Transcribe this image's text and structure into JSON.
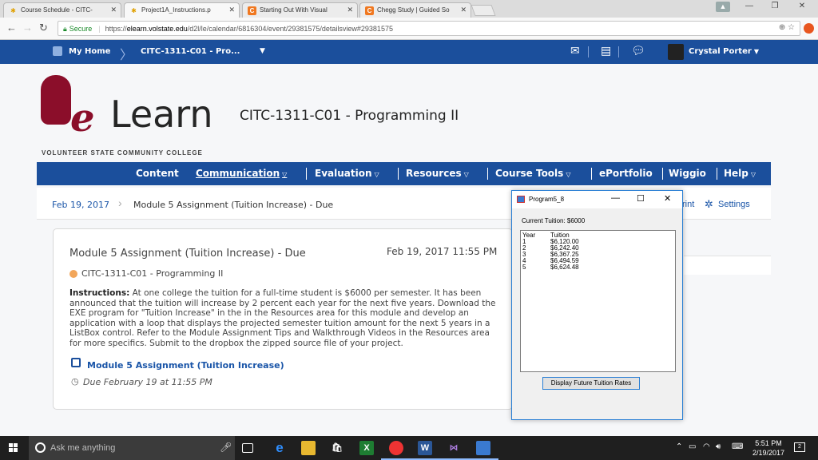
{
  "browser": {
    "tabs": [
      {
        "title": "Course Schedule - CITC-",
        "active": false
      },
      {
        "title": "Project1A_Instructions.p",
        "active": true
      },
      {
        "title": "Starting Out With Visual",
        "active": false
      },
      {
        "title": "Chegg Study | Guided So",
        "active": false
      }
    ],
    "secure_label": "Secure",
    "url_scheme": "https://",
    "url_host": "elearn.volstate.edu",
    "url_path": "/d2l/le/calendar/6816304/event/29381575/detailsview#29381575"
  },
  "sitebar": {
    "home": "My Home",
    "course_short": "CITC-1311-C01 - Pro...",
    "user": "Crystal Porter"
  },
  "logo": {
    "e": "e",
    "learn": "Learn",
    "subtitle": "Volunteer State Community College"
  },
  "course_title": "CITC-1311-C01 - Programming II",
  "main_nav": [
    "Content",
    "Communication",
    "Evaluation",
    "Resources",
    "Course Tools",
    "ePortfolio",
    "Wiggio",
    "Help"
  ],
  "breadcrumb": {
    "date": "Feb 19, 2017",
    "item": "Module 5 Assignment (Tuition Increase) - Due",
    "print": "rint",
    "settings": "Settings"
  },
  "event": {
    "title": "Module 5 Assignment (Tuition Increase) - Due",
    "date": "Feb 19, 2017 11:55 PM",
    "course": "CITC-1311-C01 - Programming II",
    "instructions_label": "Instructions:",
    "instructions_text": " At one college the tuition for a full-time student is $6000 per semester. It has been announced that the tuition will increase by 2 percent each year for the next five years. Download the EXE program for \"Tuition Increase\" in the in the Resources area for this module and develop an application with a loop that displays the projected semester tuition amount for the next 5 years in a ListBox control. Refer to the Module Assignment Tips and Walkthrough Videos in the Resources area for more specifics. Submit to the dropbox the zipped source file of your project.",
    "dropbox_link": "Module 5 Assignment (Tuition Increase)",
    "due": "Due February 19 at 11:55 PM"
  },
  "winform": {
    "title": "Program5_8",
    "current_label": "Current Tuition: $6000",
    "header_year": "Year",
    "header_tuition": "Tuition",
    "rows": [
      {
        "year": "1",
        "tuition": "$6,120.00"
      },
      {
        "year": "2",
        "tuition": "$6,242.40"
      },
      {
        "year": "3",
        "tuition": "$6,367.25"
      },
      {
        "year": "4",
        "tuition": "$6,494.59"
      },
      {
        "year": "5",
        "tuition": "$6,624.48"
      }
    ],
    "button": "Display Future Tuition Rates"
  },
  "taskbar": {
    "search_placeholder": "Ask me anything",
    "time": "5:51 PM",
    "date": "2/19/2017",
    "notifications": "2"
  },
  "colors": {
    "brand_blue": "#1b4f9c",
    "logo_red": "#8b0e2a",
    "link_blue": "#1a55a8"
  }
}
